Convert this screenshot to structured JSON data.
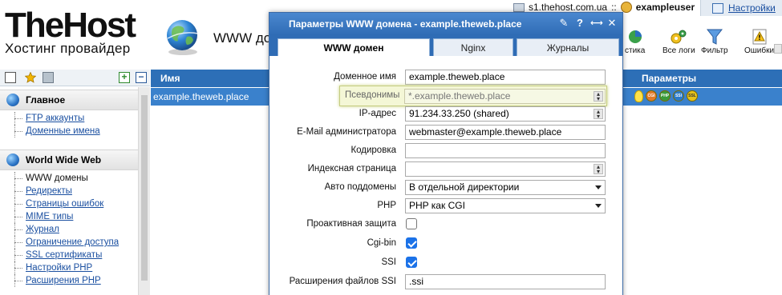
{
  "header": {
    "logo_title": "TheHost",
    "logo_subtitle": "Хостинг провайдер",
    "page_heading": "WWW домены",
    "server": "s1.thehost.com.ua",
    "server_sep": "::",
    "username": "exampleuser",
    "settings_label": "Настройки",
    "toolbar": [
      {
        "label": "стика",
        "icon": "statistics-icon"
      },
      {
        "label": "Все логи",
        "icon": "gears-icon"
      },
      {
        "label": "Фильтр",
        "icon": "filter-icon"
      },
      {
        "label": "Ошибки",
        "icon": "warning-icon"
      }
    ]
  },
  "sidebar": {
    "sections": [
      {
        "title": "Главное",
        "items": [
          {
            "label": "FTP аккаунты",
            "link": true
          },
          {
            "label": "Доменные имена",
            "link": true
          }
        ]
      },
      {
        "title": "World Wide Web",
        "items": [
          {
            "label": "WWW домены",
            "link": false
          },
          {
            "label": "Редиректы",
            "link": true
          },
          {
            "label": "Страницы ошибок",
            "link": true
          },
          {
            "label": "MIME типы",
            "link": true
          },
          {
            "label": "Журнал",
            "link": true
          },
          {
            "label": "Ограничение доступа",
            "link": true
          },
          {
            "label": "SSL сертификаты",
            "link": true
          },
          {
            "label": "Настройки PHP",
            "link": true
          },
          {
            "label": "Расширения PHP",
            "link": true
          }
        ]
      }
    ]
  },
  "list": {
    "col_name": "Имя",
    "col_params": "Параметры",
    "rows": [
      {
        "name": "example.theweb.place",
        "badges": [
          "CGI",
          "PHP",
          "SSI",
          "SSL"
        ]
      }
    ]
  },
  "dialog": {
    "title": "Параметры WWW домена - example.theweb.place",
    "tabs": [
      "WWW домен",
      "Nginx",
      "Журналы"
    ],
    "fields": {
      "domain_label": "Доменное имя",
      "domain_value": "example.theweb.place",
      "aliases_label": "Псевдонимы",
      "aliases_value": "*.example.theweb.place",
      "ip_label": "IP-адрес",
      "ip_value": "91.234.33.250 (shared)",
      "email_label": "E-Mail администратора",
      "email_value": "webmaster@example.theweb.place",
      "charset_label": "Кодировка",
      "charset_value": "",
      "index_label": "Индексная страница",
      "index_value": "",
      "autosub_label": "Авто поддомены",
      "autosub_value": "В отдельной директории",
      "php_label": "PHP",
      "php_value": "PHP как CGI",
      "proactive_label": "Проактивная защита",
      "proactive_checked": false,
      "cgibin_label": "Cgi-bin",
      "cgibin_checked": true,
      "ssi_label": "SSI",
      "ssi_checked": true,
      "ssi_ext_label": "Расширения файлов SSI",
      "ssi_ext_value": ".ssi"
    }
  },
  "colors": {
    "header_blue": "#2d6fb7",
    "row_selected": "#3a81cc",
    "dialog_title": "#2f6cb5",
    "link": "#1a4fa0",
    "highlight": "#f4f7d6"
  }
}
